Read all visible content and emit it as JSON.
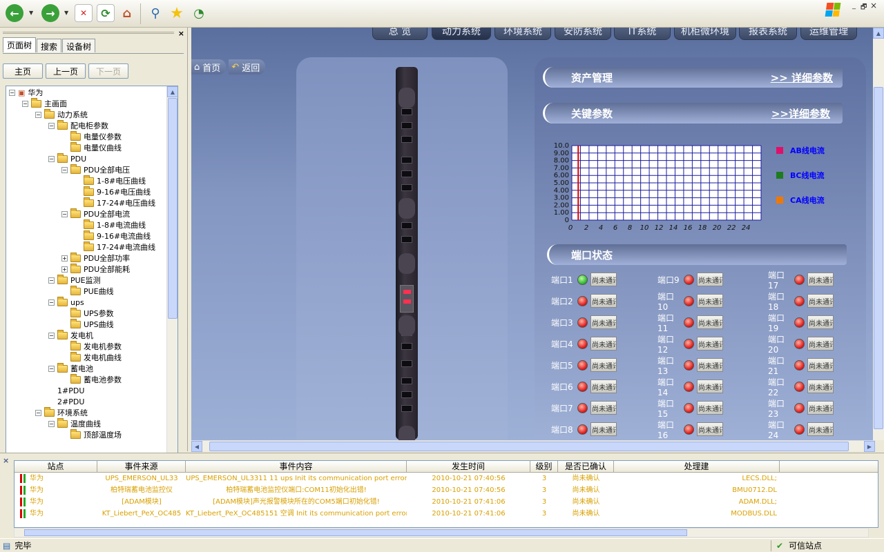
{
  "toolbar": {
    "icons": [
      "back-icon",
      "forward-icon",
      "stop-icon",
      "refresh-icon",
      "home-icon",
      "search-icon",
      "favorites-icon",
      "history-icon"
    ],
    "colors": {
      "back": "#3aa13a",
      "forward": "#3aa13a",
      "stop": "#d42020",
      "refresh": "#2e8a2e",
      "star": "#f4c20d"
    }
  },
  "window": {
    "minimize": "_",
    "restore": "🗗",
    "close": "×"
  },
  "sidebar": {
    "close_label": "×",
    "tabs": [
      "页面树",
      "搜索",
      "设备树"
    ],
    "nav": {
      "home": "主页",
      "prev": "上一页",
      "next": "下一页"
    },
    "tree": [
      {
        "label": "华为",
        "level": 0,
        "exp": "−"
      },
      {
        "label": "主画面",
        "level": 1,
        "exp": "−"
      },
      {
        "label": "动力系统",
        "level": 2,
        "exp": "−"
      },
      {
        "label": "配电柜参数",
        "level": 3,
        "exp": "−"
      },
      {
        "label": "电量仪参数",
        "level": 4,
        "exp": ""
      },
      {
        "label": "电量仪曲线",
        "level": 4,
        "exp": ""
      },
      {
        "label": "PDU",
        "level": 3,
        "exp": "−"
      },
      {
        "label": "PDU全部电压",
        "level": 4,
        "exp": "−"
      },
      {
        "label": "1-8#电压曲线",
        "level": 5,
        "exp": ""
      },
      {
        "label": "9-16#电压曲线",
        "level": 5,
        "exp": ""
      },
      {
        "label": "17-24#电压曲线",
        "level": 5,
        "exp": ""
      },
      {
        "label": "PDU全部电流",
        "level": 4,
        "exp": "−"
      },
      {
        "label": "1-8#电流曲线",
        "level": 5,
        "exp": ""
      },
      {
        "label": "9-16#电流曲线",
        "level": 5,
        "exp": ""
      },
      {
        "label": "17-24#电流曲线",
        "level": 5,
        "exp": ""
      },
      {
        "label": "PDU全部功率",
        "level": 4,
        "exp": "+"
      },
      {
        "label": "PDU全部能耗",
        "level": 4,
        "exp": "+"
      },
      {
        "label": "PUE监测",
        "level": 3,
        "exp": "−"
      },
      {
        "label": "PUE曲线",
        "level": 4,
        "exp": ""
      },
      {
        "label": "ups",
        "level": 3,
        "exp": "−"
      },
      {
        "label": "UPS参数",
        "level": 4,
        "exp": ""
      },
      {
        "label": "UPS曲线",
        "level": 4,
        "exp": ""
      },
      {
        "label": "发电机",
        "level": 3,
        "exp": "−"
      },
      {
        "label": "发电机参数",
        "level": 4,
        "exp": ""
      },
      {
        "label": "发电机曲线",
        "level": 4,
        "exp": ""
      },
      {
        "label": "蓄电池",
        "level": 3,
        "exp": "−"
      },
      {
        "label": "蓄电池参数",
        "level": 4,
        "exp": ""
      },
      {
        "label": "1#PDU",
        "level": 3,
        "exp": "",
        "nofolder": true
      },
      {
        "label": "2#PDU",
        "level": 3,
        "exp": "",
        "nofolder": true
      },
      {
        "label": "环境系统",
        "level": 2,
        "exp": "−"
      },
      {
        "label": "温度曲线",
        "level": 3,
        "exp": "−"
      },
      {
        "label": "顶部温度场",
        "level": 4,
        "exp": ""
      }
    ]
  },
  "main": {
    "tabs": [
      {
        "label": "总 览",
        "active": false
      },
      {
        "label": "动力系统",
        "active": true
      },
      {
        "label": "环境系统",
        "active": false
      },
      {
        "label": "安防系统",
        "active": false
      },
      {
        "label": "IT系统",
        "active": false
      },
      {
        "label": "机柜微环境",
        "active": false
      },
      {
        "label": "报表系统",
        "active": false
      },
      {
        "label": "运维管理",
        "active": false
      }
    ],
    "home_label": "首页",
    "back_label": "返回",
    "asset": {
      "title": "资产管理",
      "link": ">> 详细参数"
    },
    "params": {
      "title": "关键参数",
      "link": ">>详细参数"
    },
    "port_section_title": "端口状态"
  },
  "chart_data": {
    "type": "line",
    "x_ticks": [
      "0",
      "2",
      "4",
      "6",
      "8",
      "10",
      "12",
      "14",
      "16",
      "18",
      "20",
      "22",
      "24"
    ],
    "y_ticks": [
      "0",
      "1.00",
      "2.00",
      "3.00",
      "4.00",
      "5.00",
      "6.00",
      "7.00",
      "8.00",
      "9.00",
      "10.0"
    ],
    "xlim": [
      0,
      24
    ],
    "ylim": [
      0,
      10
    ],
    "grid": true,
    "legend_position": "right",
    "series": [
      {
        "name": "AB线电流",
        "color": "#e0106a",
        "values": []
      },
      {
        "name": "BC线电流",
        "color": "#1e7b1e",
        "values": []
      },
      {
        "name": "CA线电流",
        "color": "#f07800",
        "values": []
      }
    ],
    "cursor_x": 0.5,
    "colors": {
      "grid": "#1a1aa0",
      "background": "#ffffff",
      "cursor": "#e00000"
    }
  },
  "ports": [
    {
      "label": "端口1",
      "status": "green",
      "text": "尚未通讯"
    },
    {
      "label": "端口2",
      "status": "red",
      "text": "尚未通讯"
    },
    {
      "label": "端口3",
      "status": "red",
      "text": "尚未通讯"
    },
    {
      "label": "端口4",
      "status": "red",
      "text": "尚未通讯"
    },
    {
      "label": "端口5",
      "status": "red",
      "text": "尚未通讯"
    },
    {
      "label": "端口6",
      "status": "red",
      "text": "尚未通讯"
    },
    {
      "label": "端口7",
      "status": "red",
      "text": "尚未通讯"
    },
    {
      "label": "端口8",
      "status": "red",
      "text": "尚未通讯"
    },
    {
      "label": "端口9",
      "status": "red",
      "text": "尚未通讯"
    },
    {
      "label": "端口10",
      "status": "red",
      "text": "尚未通讯"
    },
    {
      "label": "端口11",
      "status": "red",
      "text": "尚未通讯"
    },
    {
      "label": "端口12",
      "status": "red",
      "text": "尚未通讯"
    },
    {
      "label": "端口13",
      "status": "red",
      "text": "尚未通讯"
    },
    {
      "label": "端口14",
      "status": "red",
      "text": "尚未通讯"
    },
    {
      "label": "端口15",
      "status": "red",
      "text": "尚未通讯"
    },
    {
      "label": "端口16",
      "status": "red",
      "text": "尚未通讯"
    },
    {
      "label": "端口17",
      "status": "red",
      "text": "尚未通讯"
    },
    {
      "label": "端口18",
      "status": "red",
      "text": "尚未通讯"
    },
    {
      "label": "端口19",
      "status": "red",
      "text": "尚未通讯"
    },
    {
      "label": "端口20",
      "status": "red",
      "text": "尚未通讯"
    },
    {
      "label": "端口21",
      "status": "red",
      "text": "尚未通讯"
    },
    {
      "label": "端口22",
      "status": "red",
      "text": "尚未通讯"
    },
    {
      "label": "端口23",
      "status": "red",
      "text": "尚未通讯"
    },
    {
      "label": "端口24",
      "status": "red",
      "text": "尚未通讯"
    }
  ],
  "events": {
    "close_label": "×",
    "columns": [
      "站点",
      "事件来源",
      "事件内容",
      "发生时间",
      "级别",
      "是否已确认",
      "处理建"
    ],
    "rows": [
      [
        "华为",
        "UPS_EMERSON_UL33",
        "UPS_EMERSON_UL3311 11 ups Init its communication port error",
        "2010-10-21 07:40:56",
        "3",
        "尚未确认",
        "LECS.DLL;"
      ],
      [
        "华为",
        "柏特瑞蓄电池监控仪",
        "柏特瑞蓄电池监控仪端口:COM11初始化出错!",
        "2010-10-21 07:40:56",
        "3",
        "尚未确认",
        "BMU0712.DL"
      ],
      [
        "华为",
        "[ADAM模块]",
        "[ADAM模块]声光报警模块所在的COM5端口初始化错!",
        "2010-10-21 07:41:06",
        "3",
        "尚未确认",
        "ADAM.DLL;"
      ],
      [
        "华为",
        "KT_Liebert_PeX_OC485",
        "KT_Liebert_PeX_OC485151 空调 Init its communication port error",
        "2010-10-21 07:41:06",
        "3",
        "尚未确认",
        "MODBUS.DLL"
      ]
    ]
  },
  "status": {
    "left": "完毕",
    "right": "可信站点"
  }
}
